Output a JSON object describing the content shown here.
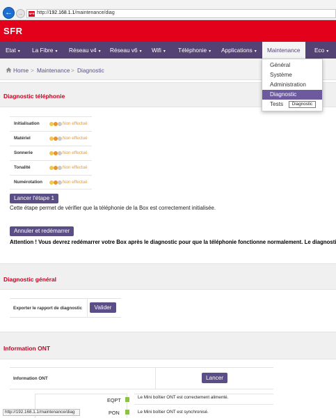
{
  "browser": {
    "url_prefix": "http://",
    "url_host": "192.168.1.1",
    "url_path": "/maintenance/diag",
    "favicon_text": "SFR",
    "back_glyph": "←",
    "forward_glyph": "→"
  },
  "brand": {
    "logo": "SFR",
    "color": "#e2001a"
  },
  "nav": {
    "items": [
      {
        "label": "Etat"
      },
      {
        "label": "La Fibre"
      },
      {
        "label": "Réseau v4"
      },
      {
        "label": "Réseau v6"
      },
      {
        "label": "Wifi"
      },
      {
        "label": "Téléphonie"
      },
      {
        "label": "Applications"
      },
      {
        "label": "Maintenance"
      },
      {
        "label": "Eco"
      }
    ],
    "caret": "▾",
    "bar_color": "#544274"
  },
  "dropdown": {
    "items": [
      {
        "label": "Général"
      },
      {
        "label": "Système"
      },
      {
        "label": "Administration"
      },
      {
        "label": "Diagnostic"
      },
      {
        "label": "Tests"
      }
    ],
    "tooltip": "Diagnostic"
  },
  "breadcrumb": {
    "home": "Home",
    "sep": ">",
    "level1": "Maintenance",
    "level2": "Diagnostic"
  },
  "telephonie": {
    "title": "Diagnostic téléphonie",
    "rows": [
      {
        "label": "Initialisation",
        "status": "Non effectué"
      },
      {
        "label": "Matériel",
        "status": "Non effectué"
      },
      {
        "label": "Sonnerie",
        "status": "Non effectué"
      },
      {
        "label": "Tonalité",
        "status": "Non effectué"
      },
      {
        "label": "Numérotation",
        "status": "Non effectué"
      }
    ],
    "step_button": "Lancer l'étape 1",
    "step_text": "Cette étape permet de vérifier que la téléphonie de la Box est correctement initialisée.",
    "restart_button": "Annuler et redémarrer",
    "warning": "Attention ! Vous devrez redémarrer votre Box après le diagnostic pour que la téléphonie fonctionne normalement. Le diagnostic"
  },
  "general": {
    "title": "Diagnostic général",
    "export_label": "Exporter le rapport de diagnostic",
    "validate_button": "Valider"
  },
  "ont": {
    "title": "Information ONT",
    "row_label": "Information ONT",
    "launch_button": "Lancer",
    "indicators": [
      {
        "label": "EQPT",
        "message": "Le Mini boîtier ONT est correctement alimenté."
      },
      {
        "label": "PON",
        "message": "Le Mini boîtier ONT est synchronisé."
      }
    ]
  },
  "status_bar": {
    "url": "http://192.168.1.1/maintenance/diag"
  }
}
